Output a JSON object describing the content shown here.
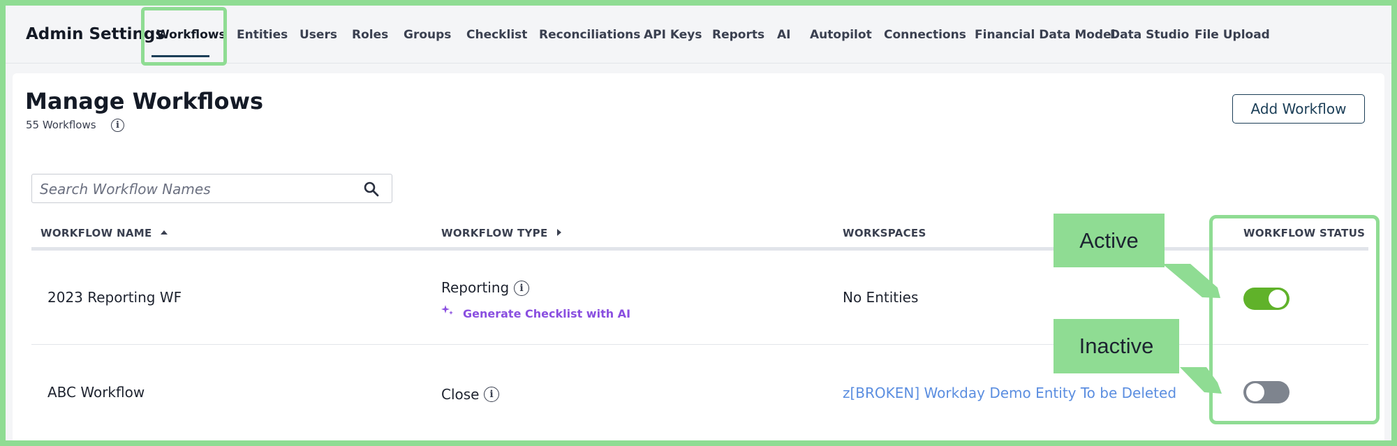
{
  "app": {
    "title": "Admin Settings"
  },
  "nav": {
    "tabs": [
      {
        "label": "Workflows",
        "active": true
      },
      {
        "label": "Entities"
      },
      {
        "label": "Users"
      },
      {
        "label": "Roles"
      },
      {
        "label": "Groups"
      },
      {
        "label": "Checklist"
      },
      {
        "label": "Reconciliations"
      },
      {
        "label": "API Keys"
      },
      {
        "label": "Reports"
      },
      {
        "label": "AI"
      },
      {
        "label": "Autopilot"
      },
      {
        "label": "Connections"
      },
      {
        "label": "Financial Data Model"
      },
      {
        "label": "Data Studio"
      },
      {
        "label": "File Upload"
      }
    ]
  },
  "page": {
    "title": "Manage Workflows",
    "count_label": "55 Workflows",
    "add_button": "Add Workflow"
  },
  "search": {
    "placeholder": "Search Workflow Names",
    "value": ""
  },
  "table": {
    "columns": [
      "WORKFLOW NAME",
      "WORKFLOW TYPE",
      "WORKSPACES",
      "WORKFLOW STATUS"
    ],
    "rows": [
      {
        "name": "2023 Reporting WF",
        "type": "Reporting",
        "action": "Generate Checklist with AI",
        "workspace": "No Entities",
        "status": "active"
      },
      {
        "name": "ABC Workflow",
        "type": "Close",
        "workspace": "z[BROKEN] Workday Demo Entity To be Deleted",
        "status": "inactive"
      }
    ]
  },
  "annotations": {
    "active": "Active",
    "inactive": "Inactive"
  },
  "colors": {
    "accent": "#1b3e57",
    "highlight": "#8fdc93",
    "toggle_on": "#60b22a",
    "toggle_off": "#7e848e",
    "link": "#5b8ee0",
    "ai": "#8a4fe0"
  }
}
